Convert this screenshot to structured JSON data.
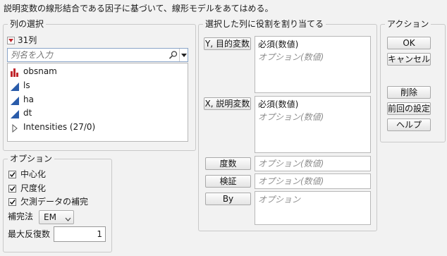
{
  "header": {
    "description": "説明変数の線形結合である因子に基づいて、線形モデルをあてはめる。"
  },
  "column_select": {
    "title": "列の選択",
    "count_label": "31列",
    "search_placeholder": "列名を入力",
    "items": [
      {
        "label": "obsnam",
        "icon": "nominal-bar-icon"
      },
      {
        "label": "ls",
        "icon": "continuous-triangle-icon"
      },
      {
        "label": "ha",
        "icon": "continuous-triangle-icon"
      },
      {
        "label": "dt",
        "icon": "continuous-triangle-icon"
      },
      {
        "label": "Intensities (27/0)",
        "icon": "disclosure-triangle-icon"
      }
    ]
  },
  "roles": {
    "title": "選択した列に役割を割り当てる",
    "y": {
      "button": "Y, 目的変数",
      "required": "必須(数値)",
      "optional": "オプション(数値)"
    },
    "x": {
      "button": "X, 説明変数",
      "required": "必須(数値)",
      "optional": "オプション(数値)"
    },
    "freq": {
      "button": "度数",
      "placeholder": "オプション(数値)"
    },
    "validation": {
      "button": "検証",
      "placeholder": "オプション(数値)"
    },
    "by": {
      "button": "By",
      "placeholder": "オプション"
    }
  },
  "actions": {
    "title": "アクション",
    "ok": "OK",
    "cancel": "キャンセル",
    "remove": "削除",
    "recall": "前回の設定",
    "help": "ヘルプ"
  },
  "options": {
    "title": "オプション",
    "centering": {
      "label": "中心化",
      "checked": true
    },
    "scaling": {
      "label": "尺度化",
      "checked": true
    },
    "impute": {
      "label": "欠測データの補完",
      "checked": true
    },
    "impute_method_label": "補完法",
    "impute_method_value": "EM",
    "max_iter_label": "最大反復数",
    "max_iter_value": "1"
  },
  "colors": {
    "accent_red": "#c0272d",
    "continuous_blue": "#2a5caa",
    "nominal_red": "#c0272d"
  }
}
